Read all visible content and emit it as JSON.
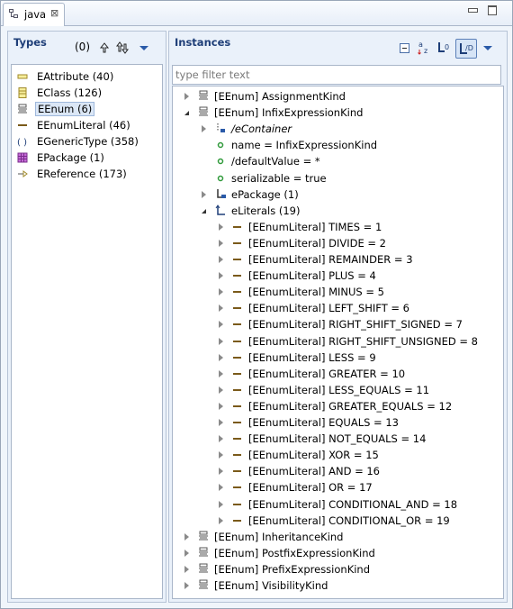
{
  "tab": {
    "label": "java",
    "close": "⊠"
  },
  "types": {
    "title": "Types",
    "count": "(0)",
    "items": [
      {
        "label": "EAttribute (40)",
        "icon": "eattribute-icon"
      },
      {
        "label": "EClass (126)",
        "icon": "eclass-icon"
      },
      {
        "label": "EEnum (6)",
        "icon": "eenum-icon",
        "selected": true
      },
      {
        "label": "EEnumLiteral (46)",
        "icon": "eenumliteral-icon"
      },
      {
        "label": "EGenericType (358)",
        "icon": "egenerictype-icon"
      },
      {
        "label": "EPackage (1)",
        "icon": "epackage-icon"
      },
      {
        "label": "EReference (173)",
        "icon": "ereference-icon"
      }
    ]
  },
  "instances": {
    "title": "Instances",
    "filter_placeholder": "type filter text",
    "rows": [
      {
        "level": 0,
        "tw": "closed",
        "icon": "eenum",
        "label": "[EEnum] AssignmentKind"
      },
      {
        "level": 0,
        "tw": "open",
        "icon": "eenum",
        "label": "[EEnum] InfixExpressionKind"
      },
      {
        "level": 1,
        "tw": "closed",
        "icon": "container",
        "label": "/eContainer",
        "italic": true
      },
      {
        "level": 1,
        "tw": "none",
        "icon": "attr",
        "label": "name = InfixExpressionKind"
      },
      {
        "level": 1,
        "tw": "none",
        "icon": "attr",
        "label": "/defaultValue = *"
      },
      {
        "level": 1,
        "tw": "none",
        "icon": "attr",
        "label": "serializable = true"
      },
      {
        "level": 1,
        "tw": "closed",
        "icon": "ref",
        "label": "ePackage (1)"
      },
      {
        "level": 1,
        "tw": "open",
        "icon": "refmany",
        "label": "eLiterals (19)"
      },
      {
        "level": 2,
        "tw": "closed",
        "icon": "literal",
        "label": "[EEnumLiteral] TIMES = 1"
      },
      {
        "level": 2,
        "tw": "closed",
        "icon": "literal",
        "label": "[EEnumLiteral] DIVIDE = 2"
      },
      {
        "level": 2,
        "tw": "closed",
        "icon": "literal",
        "label": "[EEnumLiteral] REMAINDER = 3"
      },
      {
        "level": 2,
        "tw": "closed",
        "icon": "literal",
        "label": "[EEnumLiteral] PLUS = 4"
      },
      {
        "level": 2,
        "tw": "closed",
        "icon": "literal",
        "label": "[EEnumLiteral] MINUS = 5"
      },
      {
        "level": 2,
        "tw": "closed",
        "icon": "literal",
        "label": "[EEnumLiteral] LEFT_SHIFT = 6"
      },
      {
        "level": 2,
        "tw": "closed",
        "icon": "literal",
        "label": "[EEnumLiteral] RIGHT_SHIFT_SIGNED = 7"
      },
      {
        "level": 2,
        "tw": "closed",
        "icon": "literal",
        "label": "[EEnumLiteral] RIGHT_SHIFT_UNSIGNED = 8"
      },
      {
        "level": 2,
        "tw": "closed",
        "icon": "literal",
        "label": "[EEnumLiteral] LESS = 9"
      },
      {
        "level": 2,
        "tw": "closed",
        "icon": "literal",
        "label": "[EEnumLiteral] GREATER = 10"
      },
      {
        "level": 2,
        "tw": "closed",
        "icon": "literal",
        "label": "[EEnumLiteral] LESS_EQUALS = 11"
      },
      {
        "level": 2,
        "tw": "closed",
        "icon": "literal",
        "label": "[EEnumLiteral] GREATER_EQUALS = 12"
      },
      {
        "level": 2,
        "tw": "closed",
        "icon": "literal",
        "label": "[EEnumLiteral] EQUALS = 13"
      },
      {
        "level": 2,
        "tw": "closed",
        "icon": "literal",
        "label": "[EEnumLiteral] NOT_EQUALS = 14"
      },
      {
        "level": 2,
        "tw": "closed",
        "icon": "literal",
        "label": "[EEnumLiteral] XOR = 15"
      },
      {
        "level": 2,
        "tw": "closed",
        "icon": "literal",
        "label": "[EEnumLiteral] AND = 16"
      },
      {
        "level": 2,
        "tw": "closed",
        "icon": "literal",
        "label": "[EEnumLiteral] OR = 17"
      },
      {
        "level": 2,
        "tw": "closed",
        "icon": "literal",
        "label": "[EEnumLiteral] CONDITIONAL_AND = 18"
      },
      {
        "level": 2,
        "tw": "closed",
        "icon": "literal",
        "label": "[EEnumLiteral] CONDITIONAL_OR = 19"
      },
      {
        "level": 0,
        "tw": "closed",
        "icon": "eenum",
        "label": "[EEnum] InheritanceKind"
      },
      {
        "level": 0,
        "tw": "closed",
        "icon": "eenum",
        "label": "[EEnum] PostfixExpressionKind"
      },
      {
        "level": 0,
        "tw": "closed",
        "icon": "eenum",
        "label": "[EEnum] PrefixExpressionKind"
      },
      {
        "level": 0,
        "tw": "closed",
        "icon": "eenum",
        "label": "[EEnum] VisibilityKind"
      }
    ]
  },
  "colors": {
    "accent": "#1e3e78",
    "literal": "#7a5a1a",
    "attr": "#2f9a3a",
    "package": "#9b3fb0"
  }
}
